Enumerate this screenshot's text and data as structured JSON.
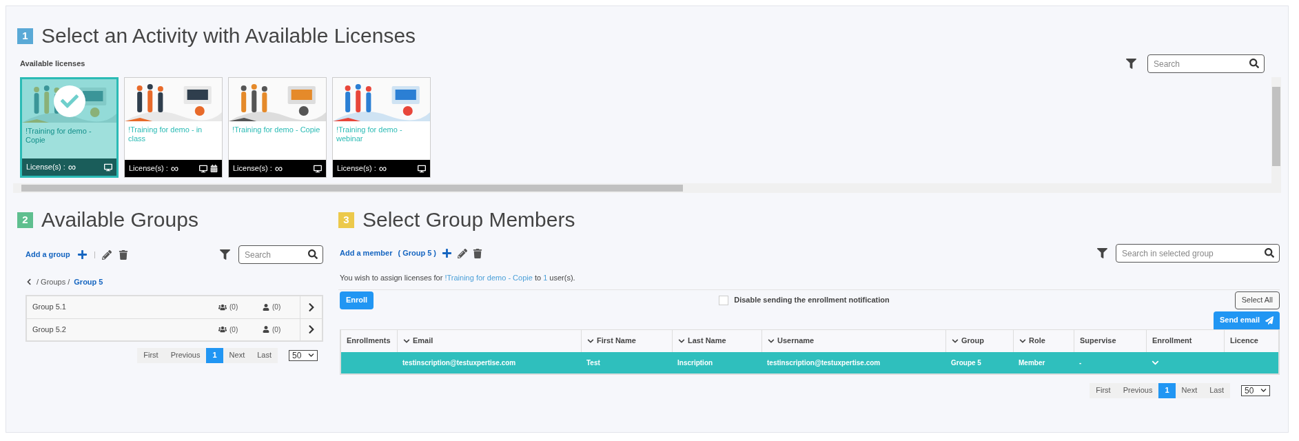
{
  "step1": {
    "number": "1",
    "color": "#5aa9d6",
    "title": "Select an Activity with Available Licenses"
  },
  "licenses": {
    "label": "Available licenses",
    "search": {
      "placeholder": "Search"
    },
    "cards": [
      {
        "title": "!Training for demo - Copie",
        "license_label": "License(s) :",
        "license_value": "∞",
        "selected": true,
        "icons": [
          {
            "kind": "monitor"
          }
        ]
      },
      {
        "title": "!Training for demo - in class",
        "license_label": "License(s) :",
        "license_value": "∞",
        "selected": false,
        "icons": [
          {
            "kind": "monitor"
          },
          {
            "kind": "calendar"
          }
        ]
      },
      {
        "title": "!Training for demo - Copie",
        "license_label": "License(s) :",
        "license_value": "∞",
        "selected": false,
        "icons": [
          {
            "kind": "monitor"
          }
        ]
      },
      {
        "title": "!Training for demo - webinar",
        "license_label": "License(s) :",
        "license_value": "∞",
        "selected": false,
        "icons": [
          {
            "kind": "monitor"
          }
        ]
      }
    ]
  },
  "step2": {
    "number": "2",
    "color": "#5fbf8f",
    "title": "Available Groups"
  },
  "groups": {
    "add_label": "Add a group",
    "search": {
      "placeholder": "Search"
    },
    "breadcrumb": {
      "path": "/ Groups /",
      "current": "Group 5"
    },
    "rows": [
      {
        "name": "Group 5.1",
        "teams": "(0)",
        "members": "(0)"
      },
      {
        "name": "Group 5.2",
        "teams": "(0)",
        "members": "(0)"
      }
    ],
    "pagination": [
      {
        "label": "First",
        "selected": false
      },
      {
        "label": "Previous",
        "selected": false
      },
      {
        "label": "1",
        "selected": true
      },
      {
        "label": "Next",
        "selected": false
      },
      {
        "label": "Last",
        "selected": false
      }
    ],
    "page_size": "50"
  },
  "step3": {
    "number": "3",
    "color": "#ecc94b",
    "title": "Select Group Members"
  },
  "members": {
    "add_label": "Add a member",
    "group_ref": "( Group 5 )",
    "search": {
      "placeholder": "Search in selected group"
    },
    "notice": {
      "prefix": "You wish to assign licenses for",
      "activity": "!Training for demo - Copie",
      "middle": "to",
      "count": "1",
      "suffix": "user(s)."
    },
    "enroll": "Enroll",
    "notification": {
      "label": "Disable sending the enrollment notification",
      "checked": false
    },
    "select_all": "Select All",
    "send_email": "Send email",
    "columns": [
      {
        "label": "Enrollments",
        "sortable": false
      },
      {
        "label": "Email",
        "sortable": true
      },
      {
        "label": "First Name",
        "sortable": true
      },
      {
        "label": "Last Name",
        "sortable": true
      },
      {
        "label": "Username",
        "sortable": true
      },
      {
        "label": "Group",
        "sortable": true
      },
      {
        "label": "Role",
        "sortable": true
      },
      {
        "label": "Supervise",
        "sortable": false
      },
      {
        "label": "Enrollment",
        "sortable": false
      },
      {
        "label": "Licence",
        "sortable": false
      }
    ],
    "rows": [
      {
        "selected": true,
        "email": "testinscription@testuxpertise.com",
        "first_name": "Test",
        "last_name": "Inscription",
        "username": "testinscription@testuxpertise.com",
        "group": "Groupe 5",
        "role": "Member",
        "supervise": "-"
      }
    ],
    "pagination": [
      {
        "label": "First",
        "selected": false
      },
      {
        "label": "Previous",
        "selected": false
      },
      {
        "label": "1",
        "selected": true
      },
      {
        "label": "Next",
        "selected": false
      },
      {
        "label": "Last",
        "selected": false
      }
    ],
    "page_size": "50"
  }
}
